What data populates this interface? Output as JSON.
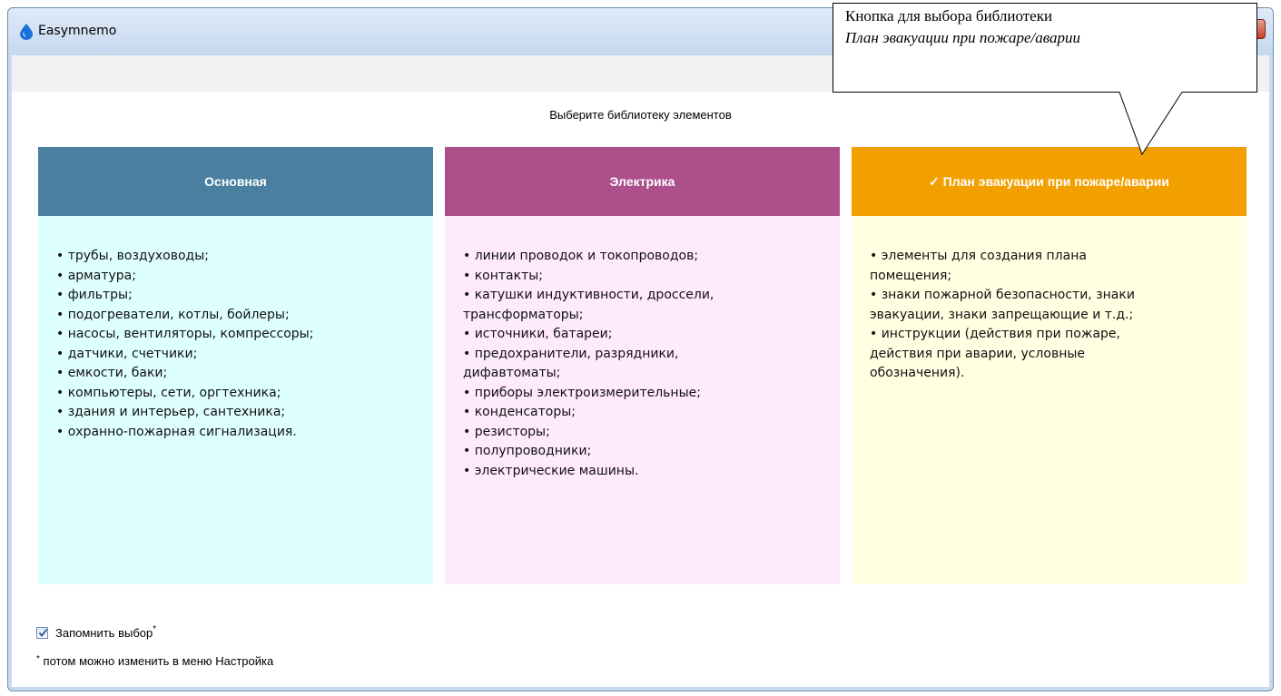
{
  "window": {
    "title": "Easymnemo",
    "app_icon": "water-drop-icon",
    "accent_color": "#1a73d9"
  },
  "dialog": {
    "prompt": "Выберите библиотеку элементов",
    "libraries": [
      {
        "title": "Основная",
        "selected": false,
        "header_color": "#4a7f9f",
        "body_color": "#deffff",
        "items": [
          "• трубы, воздуховоды;",
          "• арматура;",
          "• фильтры;",
          "• подогреватели, котлы, бойлеры;",
          "• насосы, вентиляторы, компрессоры;",
          "• датчики, счетчики;",
          "• емкости, баки;",
          "• компьютеры, сети, оргтехника;",
          "• здания и интерьер, сантехника;",
          "• охранно-пожарная сигнализация."
        ]
      },
      {
        "title": "Электрика",
        "selected": false,
        "header_color": "#ac4f8a",
        "body_color": "#ffe9fd",
        "items": [
          "• линии проводок и токопроводов;",
          "• контакты;",
          "• катушки индуктивности, дроссели,",
          "трансформаторы;",
          "• источники, батареи;",
          "• предохранители, разрядники,",
          "дифавтоматы;",
          "• приборы электроизмерительные;",
          "• конденсаторы;",
          "• резисторы;",
          "• полупроводники;",
          "• электрические машины."
        ]
      },
      {
        "title": "✓ План эвакуации при пожаре/аварии",
        "selected": true,
        "header_color": "#f29f00",
        "body_color": "#ffffe2",
        "items": [
          "• элементы для создания плана",
          "помещения;",
          "• знаки пожарной безопасности, знаки",
          "эвакуации, знаки запрещающие и т.д.;",
          "• инструкции (действия при пожаре,",
          "действия при аварии, условные",
          "обозначения)."
        ]
      }
    ],
    "remember": {
      "label": "Запомнить выбор",
      "marker": "*",
      "checked": true
    },
    "note": {
      "marker": "*",
      "text": "потом можно изменить в меню Настройка"
    }
  },
  "callout": {
    "line1": "Кнопка для выбора библиотеки",
    "line2": "План эвакуации при пожаре/аварии"
  }
}
